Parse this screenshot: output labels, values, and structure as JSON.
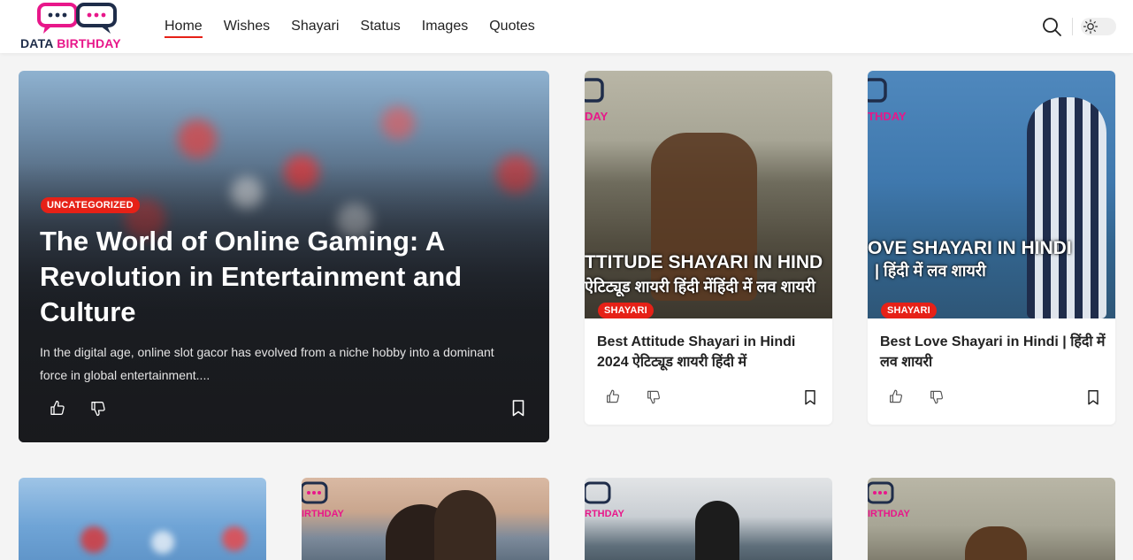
{
  "header": {
    "logo": {
      "word1": "DATA",
      "word2": "BIRTHDAY"
    },
    "nav": [
      {
        "label": "Home",
        "active": true
      },
      {
        "label": "Wishes",
        "active": false
      },
      {
        "label": "Shayari",
        "active": false
      },
      {
        "label": "Status",
        "active": false
      },
      {
        "label": "Images",
        "active": false
      },
      {
        "label": "Quotes",
        "active": false
      }
    ],
    "icons": {
      "search": "search-icon",
      "theme": "sun-icon"
    }
  },
  "featured": {
    "category": "UNCATEGORIZED",
    "title": "The World of Online Gaming: A Revolution in Entertainment and Culture",
    "excerpt": "In the digital age, online slot gacor has evolved from a niche hobby into a dominant force in global entertainment....",
    "actions": [
      "thumbs-up-icon",
      "thumbs-down-icon",
      "bookmark-icon"
    ]
  },
  "cards": [
    {
      "category": "SHAYARI",
      "title": "Best Attitude Shayari in Hindi 2024 ऐटिट्यूड शायरी हिंदी में",
      "thumb_watermark": "DAY",
      "thumb_line1": "TTITUDE SHAYARI IN HIND",
      "thumb_line2": "ऐटिट्यूड शायरी हिंदी मेंहिंदी में लव शायरी"
    },
    {
      "category": "SHAYARI",
      "title": "Best Love Shayari in Hindi | हिंदी में लव शायरी",
      "thumb_watermark": "THDAY",
      "thumb_line1": "OVE SHAYARI IN HINDI",
      "thumb_line2": "| हिंदी में लव शायरी"
    }
  ],
  "bottom_cards": [
    {
      "watermark": ""
    },
    {
      "watermark": "IRTHDAY"
    },
    {
      "watermark": "RTHDAY"
    },
    {
      "watermark": "IRTHDAY"
    }
  ],
  "colors": {
    "accent": "#e62117",
    "logo_pink": "#e8178a",
    "logo_navy": "#1f2d4a"
  }
}
